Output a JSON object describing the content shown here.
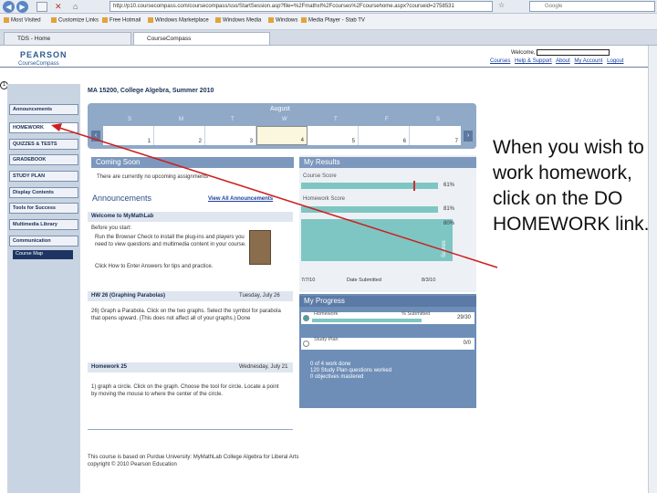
{
  "browser": {
    "url": "http://p10.coursecompass.com/coursecompass/sso/StartSession.asp?file=%2Fmathxl%2Fcourses%2Fcoursehome.aspx?courseid=2758531",
    "search_placeholder": "Google",
    "favorites": [
      "Most Visited",
      "Customize Links",
      "Free Hotmail",
      "Windows Marketplace",
      "Windows Media",
      "Windows",
      "Media Player - Stab TV"
    ],
    "tabs": [
      "TDS - Home",
      "CourseCompass"
    ]
  },
  "header": {
    "brand": "PEARSON",
    "product": "CourseCompass",
    "welcome": "Welcome,",
    "links": [
      "Courses",
      "Help & Support",
      "About",
      "My Account",
      "Logout"
    ]
  },
  "sidenav": {
    "items": [
      "Announcements",
      "HOMEWORK",
      "QUIZZES & TESTS",
      "GRADEBOOK",
      "STUDY PLAN",
      "Display Contents",
      "Tools for Success",
      "Multimedia Library",
      "Communication"
    ],
    "course_map": "Course Map"
  },
  "course": {
    "title": "MA 15200, College Algebra, Summer 2010"
  },
  "calendar": {
    "month": "August",
    "weekdays": [
      "S",
      "M",
      "T",
      "W",
      "T",
      "F",
      "S"
    ],
    "days": [
      "1",
      "2",
      "3",
      "4",
      "5",
      "6",
      "7"
    ],
    "today_index": 3
  },
  "coming_soon": {
    "title": "Coming Soon",
    "text": "There are currently no upcoming assignments"
  },
  "announcements": {
    "title": "Announcements",
    "view_all": "View All Announcements",
    "welcome_header": "Welcome to MyMathLab",
    "before_start": "Before you start:",
    "bullet1": "Run the Browser Check to install the plug-ins and players you need to view questions and multimedia content in your course.",
    "bullet2": "Click How to Enter Answers for tips and practice.",
    "hw26_title": "HW 26 (Graphing Parabolas)",
    "hw26_date": "Tuesday, July 26",
    "hw26_text": "26) Graph a Parabola. Click on the two graphs. Select the symbol for parabola that opens upward. (This does not affect all of your graphs.) Done",
    "hw25_title": "Homework 25",
    "hw25_date": "Wednesday, July 21",
    "hw25_text": "1) graph a circle. Click on the graph. Choose the tool for circle. Locate a point by moving the mouse to where the center of the circle.",
    "footer": "This course is based on Purdue University: MyMathLab College Algebra for Liberal Arts",
    "copyright": "copyright © 2010 Pearson Education"
  },
  "results": {
    "title": "My Results",
    "course_score_label": "Course Score",
    "course_score": "61%",
    "homework_label": "Homework Score",
    "homework_score": "81%",
    "goal": "80%",
    "chart_left": "7/7/10",
    "chart_mid": "Date Submitted",
    "chart_right": "8/3/10",
    "chart_axis": "Scores"
  },
  "progress": {
    "title": "My Progress",
    "homework_label": "Homework",
    "homework_col": "% Submitted",
    "homework_val": "29/30",
    "study_label": "Study Plan",
    "study_val": "0/0",
    "list": [
      "0 of 4 work done",
      "120 Study Plan questions worked",
      "0 objectives mastered"
    ]
  },
  "annotation": {
    "text": "When you wish to work homework, click on the DO HOMEWORK link."
  }
}
